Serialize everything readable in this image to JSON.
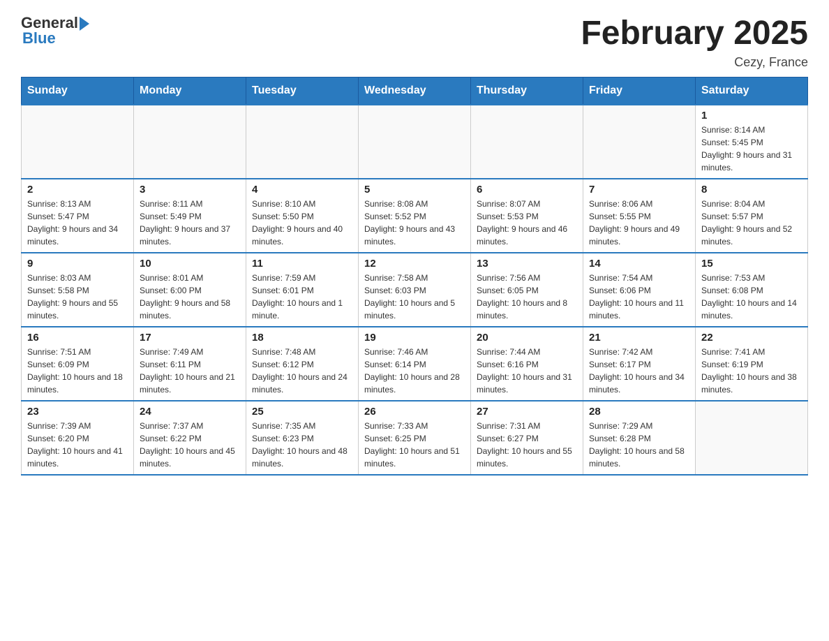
{
  "header": {
    "logo_general": "General",
    "logo_blue": "Blue",
    "month_title": "February 2025",
    "location": "Cezy, France"
  },
  "days_of_week": [
    "Sunday",
    "Monday",
    "Tuesday",
    "Wednesday",
    "Thursday",
    "Friday",
    "Saturday"
  ],
  "weeks": [
    {
      "days": [
        {
          "num": "",
          "info": ""
        },
        {
          "num": "",
          "info": ""
        },
        {
          "num": "",
          "info": ""
        },
        {
          "num": "",
          "info": ""
        },
        {
          "num": "",
          "info": ""
        },
        {
          "num": "",
          "info": ""
        },
        {
          "num": "1",
          "info": "Sunrise: 8:14 AM\nSunset: 5:45 PM\nDaylight: 9 hours and 31 minutes."
        }
      ]
    },
    {
      "days": [
        {
          "num": "2",
          "info": "Sunrise: 8:13 AM\nSunset: 5:47 PM\nDaylight: 9 hours and 34 minutes."
        },
        {
          "num": "3",
          "info": "Sunrise: 8:11 AM\nSunset: 5:49 PM\nDaylight: 9 hours and 37 minutes."
        },
        {
          "num": "4",
          "info": "Sunrise: 8:10 AM\nSunset: 5:50 PM\nDaylight: 9 hours and 40 minutes."
        },
        {
          "num": "5",
          "info": "Sunrise: 8:08 AM\nSunset: 5:52 PM\nDaylight: 9 hours and 43 minutes."
        },
        {
          "num": "6",
          "info": "Sunrise: 8:07 AM\nSunset: 5:53 PM\nDaylight: 9 hours and 46 minutes."
        },
        {
          "num": "7",
          "info": "Sunrise: 8:06 AM\nSunset: 5:55 PM\nDaylight: 9 hours and 49 minutes."
        },
        {
          "num": "8",
          "info": "Sunrise: 8:04 AM\nSunset: 5:57 PM\nDaylight: 9 hours and 52 minutes."
        }
      ]
    },
    {
      "days": [
        {
          "num": "9",
          "info": "Sunrise: 8:03 AM\nSunset: 5:58 PM\nDaylight: 9 hours and 55 minutes."
        },
        {
          "num": "10",
          "info": "Sunrise: 8:01 AM\nSunset: 6:00 PM\nDaylight: 9 hours and 58 minutes."
        },
        {
          "num": "11",
          "info": "Sunrise: 7:59 AM\nSunset: 6:01 PM\nDaylight: 10 hours and 1 minute."
        },
        {
          "num": "12",
          "info": "Sunrise: 7:58 AM\nSunset: 6:03 PM\nDaylight: 10 hours and 5 minutes."
        },
        {
          "num": "13",
          "info": "Sunrise: 7:56 AM\nSunset: 6:05 PM\nDaylight: 10 hours and 8 minutes."
        },
        {
          "num": "14",
          "info": "Sunrise: 7:54 AM\nSunset: 6:06 PM\nDaylight: 10 hours and 11 minutes."
        },
        {
          "num": "15",
          "info": "Sunrise: 7:53 AM\nSunset: 6:08 PM\nDaylight: 10 hours and 14 minutes."
        }
      ]
    },
    {
      "days": [
        {
          "num": "16",
          "info": "Sunrise: 7:51 AM\nSunset: 6:09 PM\nDaylight: 10 hours and 18 minutes."
        },
        {
          "num": "17",
          "info": "Sunrise: 7:49 AM\nSunset: 6:11 PM\nDaylight: 10 hours and 21 minutes."
        },
        {
          "num": "18",
          "info": "Sunrise: 7:48 AM\nSunset: 6:12 PM\nDaylight: 10 hours and 24 minutes."
        },
        {
          "num": "19",
          "info": "Sunrise: 7:46 AM\nSunset: 6:14 PM\nDaylight: 10 hours and 28 minutes."
        },
        {
          "num": "20",
          "info": "Sunrise: 7:44 AM\nSunset: 6:16 PM\nDaylight: 10 hours and 31 minutes."
        },
        {
          "num": "21",
          "info": "Sunrise: 7:42 AM\nSunset: 6:17 PM\nDaylight: 10 hours and 34 minutes."
        },
        {
          "num": "22",
          "info": "Sunrise: 7:41 AM\nSunset: 6:19 PM\nDaylight: 10 hours and 38 minutes."
        }
      ]
    },
    {
      "days": [
        {
          "num": "23",
          "info": "Sunrise: 7:39 AM\nSunset: 6:20 PM\nDaylight: 10 hours and 41 minutes."
        },
        {
          "num": "24",
          "info": "Sunrise: 7:37 AM\nSunset: 6:22 PM\nDaylight: 10 hours and 45 minutes."
        },
        {
          "num": "25",
          "info": "Sunrise: 7:35 AM\nSunset: 6:23 PM\nDaylight: 10 hours and 48 minutes."
        },
        {
          "num": "26",
          "info": "Sunrise: 7:33 AM\nSunset: 6:25 PM\nDaylight: 10 hours and 51 minutes."
        },
        {
          "num": "27",
          "info": "Sunrise: 7:31 AM\nSunset: 6:27 PM\nDaylight: 10 hours and 55 minutes."
        },
        {
          "num": "28",
          "info": "Sunrise: 7:29 AM\nSunset: 6:28 PM\nDaylight: 10 hours and 58 minutes."
        },
        {
          "num": "",
          "info": ""
        }
      ]
    }
  ]
}
